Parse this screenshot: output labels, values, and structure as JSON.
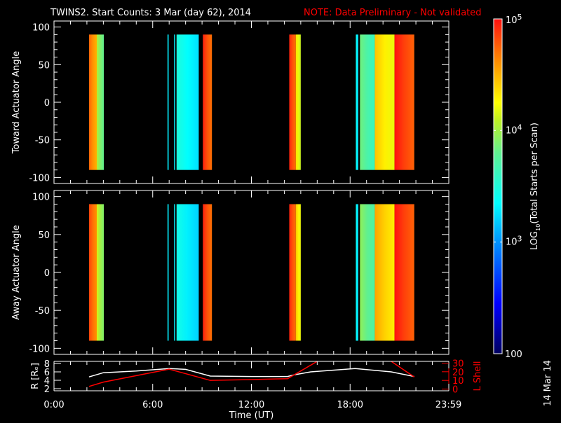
{
  "title": "TWINS2. Start Counts:  3 Mar (day  62), 2014",
  "note": "NOTE: Data Preliminary - Not validated",
  "date_stamp": "14 Mar 14",
  "colors": {
    "background": "#000000",
    "axes": "#ffffff",
    "note": "#ff0000",
    "lshell": "#ff0000",
    "radius": "#ffffff"
  },
  "chart_data": [
    {
      "type": "heatmap",
      "name": "toward",
      "ylabel": "Toward Actuator Angle",
      "ylim": [
        -108,
        108
      ],
      "yticks": [
        "100",
        "50",
        "0",
        "-50",
        "-100"
      ],
      "ytick_values": [
        100,
        50,
        0,
        -50,
        -100
      ],
      "xlim": [
        0,
        24
      ],
      "data_blocks_hours": [
        {
          "start": 2.13,
          "end": 2.6,
          "level": 4.6
        },
        {
          "start": 2.6,
          "end": 3.03,
          "level": 3.9
        },
        {
          "start": 6.9,
          "end": 6.97,
          "level": 3.3
        },
        {
          "start": 7.3,
          "end": 7.36,
          "level": 3.3
        },
        {
          "start": 7.45,
          "end": 8.8,
          "level": 3.35
        },
        {
          "start": 9.05,
          "end": 9.6,
          "level": 4.8
        },
        {
          "start": 14.3,
          "end": 14.7,
          "level": 4.8
        },
        {
          "start": 14.7,
          "end": 15.0,
          "level": 4.2
        },
        {
          "start": 18.35,
          "end": 18.5,
          "level": 3.3
        },
        {
          "start": 18.6,
          "end": 19.5,
          "level": 3.7
        },
        {
          "start": 19.5,
          "end": 20.7,
          "level": 4.3
        },
        {
          "start": 20.7,
          "end": 21.9,
          "level": 4.85
        }
      ]
    },
    {
      "type": "heatmap",
      "name": "away",
      "ylabel": "Away Actuator Angle",
      "ylim": [
        -108,
        108
      ],
      "yticks": [
        "100",
        "50",
        "0",
        "-50",
        "-100"
      ],
      "ytick_values": [
        100,
        50,
        0,
        -50,
        -100
      ],
      "xlim": [
        0,
        24
      ],
      "data_blocks_hours": [
        {
          "start": 2.13,
          "end": 2.6,
          "level": 4.7
        },
        {
          "start": 2.6,
          "end": 3.03,
          "level": 4.0
        },
        {
          "start": 6.9,
          "end": 6.97,
          "level": 3.3
        },
        {
          "start": 7.3,
          "end": 7.36,
          "level": 3.3
        },
        {
          "start": 7.45,
          "end": 8.8,
          "level": 3.3
        },
        {
          "start": 9.05,
          "end": 9.6,
          "level": 4.8
        },
        {
          "start": 14.3,
          "end": 14.7,
          "level": 4.8
        },
        {
          "start": 14.7,
          "end": 15.0,
          "level": 4.3
        },
        {
          "start": 18.35,
          "end": 18.5,
          "level": 3.3
        },
        {
          "start": 18.6,
          "end": 19.5,
          "level": 3.8
        },
        {
          "start": 19.5,
          "end": 20.7,
          "level": 4.4
        },
        {
          "start": 20.7,
          "end": 21.9,
          "level": 4.85
        }
      ]
    },
    {
      "type": "line",
      "name": "orbit",
      "ylabel": "R [Rₑ]",
      "ylim": [
        1.5,
        8.5
      ],
      "yticks": [
        "8",
        "6",
        "4",
        "2"
      ],
      "ytick_values": [
        8,
        6,
        4,
        2
      ],
      "y2label": "L Shell",
      "y2lim": [
        -2,
        32
      ],
      "y2ticks": [
        "30",
        "20",
        "10",
        "0"
      ],
      "y2tick_values": [
        30,
        20,
        10,
        0
      ],
      "xlabel": "Time (UT)",
      "xlim": [
        0,
        24
      ],
      "xticks": [
        "0:00",
        "6:00",
        "12:00",
        "18:00",
        "23:59"
      ],
      "xtick_values": [
        0,
        6,
        12,
        18,
        23.98
      ],
      "series": [
        {
          "name": "R",
          "x": [
            2.13,
            3.0,
            5.0,
            7.0,
            8.0,
            9.5,
            12.0,
            14.2,
            14.6,
            15.6,
            18.3,
            20.5,
            21.9
          ],
          "y": [
            4.8,
            5.8,
            6.2,
            6.8,
            6.6,
            5.0,
            4.9,
            4.9,
            5.3,
            6.0,
            6.8,
            6.0,
            4.9
          ]
        },
        {
          "name": "L Shell",
          "x": [
            2.13,
            3.0,
            7.0,
            9.5,
            12.0,
            14.2,
            16.0
          ],
          "y": [
            3,
            8,
            23,
            10,
            11,
            12,
            32
          ]
        },
        {
          "name": "L Shell 2",
          "x": [
            20.5,
            21.9
          ],
          "y": [
            32,
            14
          ]
        }
      ]
    },
    {
      "type": "colorbar",
      "label": "LOG",
      "label_sub": "10",
      "label_rest": "(Total Starts per Scan)",
      "range_log": [
        2,
        5
      ],
      "tick_labels": [
        {
          "base": "10",
          "exp": "5",
          "log": 5
        },
        {
          "base": "10",
          "exp": "4",
          "log": 4
        },
        {
          "base": "10",
          "exp": "3",
          "log": 3
        },
        {
          "base": "",
          "exp": "",
          "text": "100",
          "log": 2
        }
      ]
    }
  ]
}
